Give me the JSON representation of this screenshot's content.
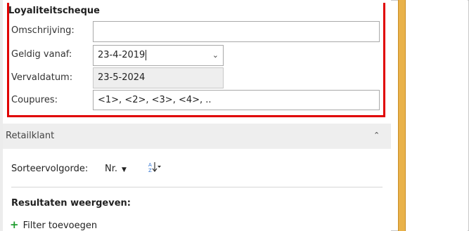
{
  "loyalty": {
    "title": "Loyaliteitscheque",
    "fields": {
      "omschrijving": {
        "label": "Omschrijving:",
        "value": ""
      },
      "geldig_vanaf": {
        "label": "Geldig vanaf:",
        "value": "23-4-2019"
      },
      "vervaldatum": {
        "label": "Vervaldatum:",
        "value": "23-5-2024"
      },
      "coupures": {
        "label": "Coupures:",
        "value": "<1>, <2>, <3>, <4>, .."
      }
    }
  },
  "retail": {
    "title": "Retailklant",
    "sort_label": "Sorteervolgorde:",
    "sort_value": "Nr.",
    "results_label": "Resultaten weergeven:",
    "add_filter_label": "Filter toevoegen"
  },
  "icons": {
    "dropdown": "chevron-down-icon",
    "collapse": "chevron-up-icon",
    "sort": "sort-az-icon",
    "add": "plus-icon"
  },
  "colors": {
    "highlight_border": "#e00000",
    "splitter": "#e9b24a",
    "add_icon": "#1e9c2e"
  }
}
